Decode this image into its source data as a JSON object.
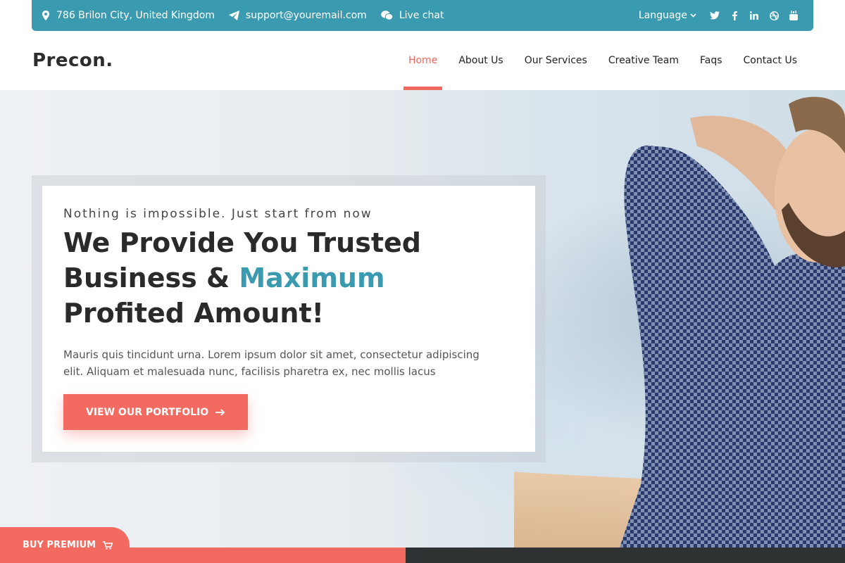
{
  "topbar": {
    "address": "786 Brilon City, United Kingdom",
    "email": "support@youremail.com",
    "chat": "Live chat",
    "language": "Language",
    "socials": [
      "twitter-icon",
      "facebook-icon",
      "linkedin-icon",
      "dribbble-icon",
      "youtube-icon"
    ]
  },
  "nav": {
    "logo": "Precon.",
    "items": [
      "Home",
      "About Us",
      "Our Services",
      "Creative Team",
      "Faqs",
      "Contact Us"
    ],
    "active": "Home"
  },
  "hero": {
    "kicker": "Nothing is impossible. Just start from now",
    "headline_part1": "We Provide You Trusted Business & ",
    "headline_accent": "Maximum",
    "headline_part2": " Profited Amount!",
    "description": "Mauris quis tincidunt urna. Lorem ipsum dolor sit amet, consectetur adipiscing elit. Aliquam et malesuada nunc, facilisis pharetra ex, nec mollis lacus",
    "cta": "VIEW OUR PORTFOLIO"
  },
  "buy_premium": "BUY PREMIUM",
  "colors": {
    "primary": "#3a9bb0",
    "accent": "#f26a60",
    "dark": "#2f3233"
  }
}
